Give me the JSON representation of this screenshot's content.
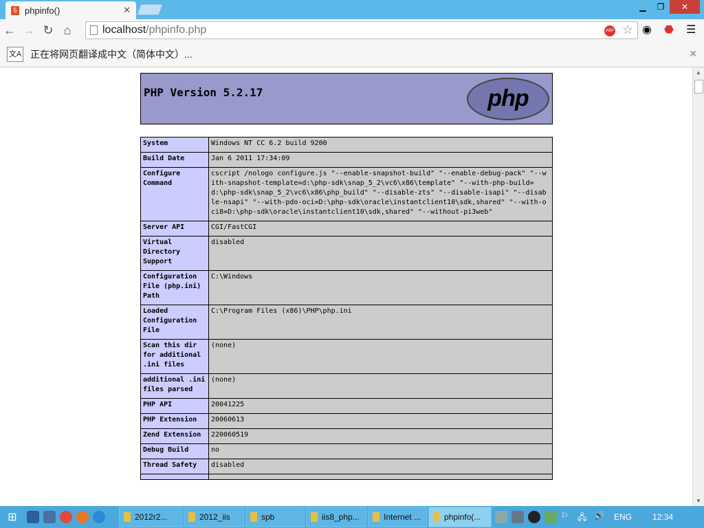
{
  "browser": {
    "tab_title": "phpinfo()",
    "url_host": "localhost",
    "url_path": "/phpinfo.php",
    "translate_text": "正在将网页翻译成中文（简体中文）..."
  },
  "php": {
    "version_title": "PHP Version 5.2.17",
    "logo_text": "php",
    "rows": [
      {
        "k": "System",
        "v": "Windows NT CC 6.2 build 9200"
      },
      {
        "k": "Build Date",
        "v": "Jan 6 2011 17:34:09"
      },
      {
        "k": "Configure Command",
        "v": "cscript /nologo configure.js \"--enable-snapshot-build\" \"--enable-debug-pack\" \"--with-snapshot-template=d:\\php-sdk\\snap_5_2\\vc6\\x86\\template\" \"--with-php-build=d:\\php-sdk\\snap_5_2\\vc6\\x86\\php_build\" \"--disable-zts\" \"--disable-isapi\" \"--disable-nsapi\" \"--with-pdo-oci=D:\\php-sdk\\oracle\\instantclient10\\sdk,shared\" \"--with-oci8=D:\\php-sdk\\oracle\\instantclient10\\sdk,shared\" \"--without-pi3web\""
      },
      {
        "k": "Server API",
        "v": "CGI/FastCGI"
      },
      {
        "k": "Virtual Directory Support",
        "v": "disabled"
      },
      {
        "k": "Configuration File (php.ini) Path",
        "v": "C:\\Windows"
      },
      {
        "k": "Loaded Configuration File",
        "v": "C:\\Program Files (x86)\\PHP\\php.ini"
      },
      {
        "k": "Scan this dir for additional .ini files",
        "v": "(none)"
      },
      {
        "k": "additional .ini files parsed",
        "v": "(none)"
      },
      {
        "k": "PHP API",
        "v": "20041225"
      },
      {
        "k": "PHP Extension",
        "v": "20060613"
      },
      {
        "k": "Zend Extension",
        "v": "220060519"
      },
      {
        "k": "Debug Build",
        "v": "no"
      },
      {
        "k": "Thread Safety",
        "v": "disabled"
      },
      {
        "k": "",
        "v": ""
      }
    ]
  },
  "taskbar": {
    "windows": [
      "2012r2...",
      "2012_iis",
      "spb",
      "iis8_php...",
      "Internet ...",
      "phpinfo(..."
    ],
    "lang": "ENG",
    "time": "12:34"
  }
}
